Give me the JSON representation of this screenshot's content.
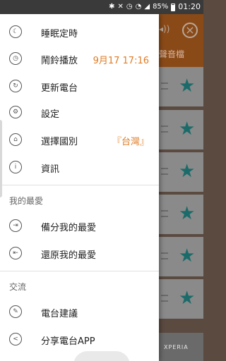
{
  "status_bar": {
    "battery": "85%",
    "time": "01:20",
    "icons": [
      "bluetooth-icon",
      "mute-icon",
      "alarm-icon",
      "wifi-icon",
      "signal-icon"
    ]
  },
  "background": {
    "tab_label": "聲音檔",
    "ad_text": "XPERIA"
  },
  "drawer": {
    "items_top": [
      {
        "label": "睡眠定時",
        "icon": "moon-icon",
        "value": ""
      },
      {
        "label": "鬧鈴播放",
        "icon": "alarm-clock-icon",
        "value": "9月17 17:16"
      },
      {
        "label": "更新電台",
        "icon": "refresh-icon",
        "value": ""
      },
      {
        "label": "設定",
        "icon": "gear-icon",
        "value": ""
      },
      {
        "label": "選擇國別",
        "icon": "home-icon",
        "value": "『台灣』"
      },
      {
        "label": "資訊",
        "icon": "info-icon",
        "value": ""
      }
    ],
    "favorites_header": "我的最愛",
    "items_favorites": [
      {
        "label": "備分我的最愛",
        "icon": "backup-icon"
      },
      {
        "label": "還原我的最愛",
        "icon": "restore-icon"
      }
    ],
    "exchange_header": "交流",
    "items_exchange": [
      {
        "label": "電台建議",
        "icon": "feedback-icon"
      },
      {
        "label": "分享電台APP",
        "icon": "share-icon"
      }
    ]
  },
  "colors": {
    "accent": "#e07b24",
    "star": "#1b6b6a"
  }
}
